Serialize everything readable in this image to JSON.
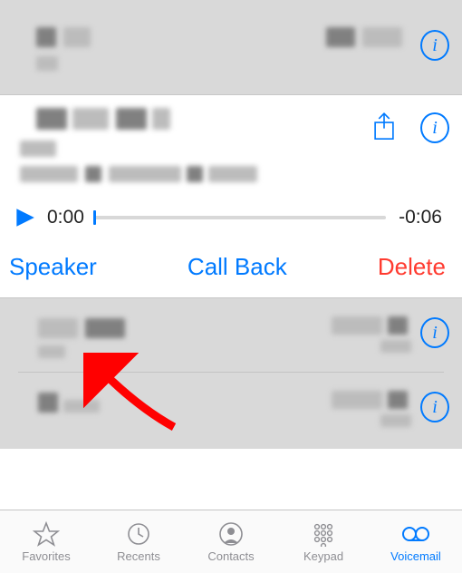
{
  "colors": {
    "accent": "#007aff",
    "danger": "#ff3b30"
  },
  "collapsed_items": [
    {
      "position": "top"
    },
    {
      "position": "mid"
    },
    {
      "position": "last"
    }
  ],
  "expanded": {
    "elapsed": "0:00",
    "remaining": "-0:06",
    "speaker_label": "Speaker",
    "callback_label": "Call Back",
    "delete_label": "Delete"
  },
  "tabs": {
    "favorites": "Favorites",
    "recents": "Recents",
    "contacts": "Contacts",
    "keypad": "Keypad",
    "voicemail": "Voicemail",
    "active": "voicemail"
  },
  "icons": {
    "info": "info-icon",
    "share": "share-icon",
    "play": "play-icon"
  }
}
